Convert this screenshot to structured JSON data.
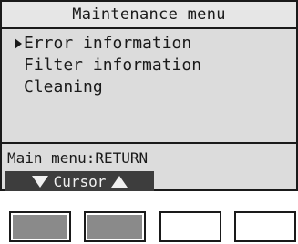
{
  "screen": {
    "title": "Maintenance menu",
    "menu_items": [
      {
        "label": "Error information",
        "selected": true
      },
      {
        "label": "Filter information",
        "selected": false
      },
      {
        "label": "Cleaning",
        "selected": false
      }
    ],
    "footer_text": "Main menu:RETURN",
    "softkey_label": "Cursor",
    "softkey_icons": [
      "triangle-down-icon",
      "triangle-up-icon"
    ]
  },
  "function_keys": [
    {
      "name": "function-key-1",
      "active": true
    },
    {
      "name": "function-key-2",
      "active": true
    },
    {
      "name": "function-key-3",
      "active": false
    },
    {
      "name": "function-key-4",
      "active": false
    }
  ],
  "colors": {
    "lcd_background": "#dcdcdc",
    "softkey_background": "#3d3d3d",
    "active_key": "#8a8a8a"
  }
}
